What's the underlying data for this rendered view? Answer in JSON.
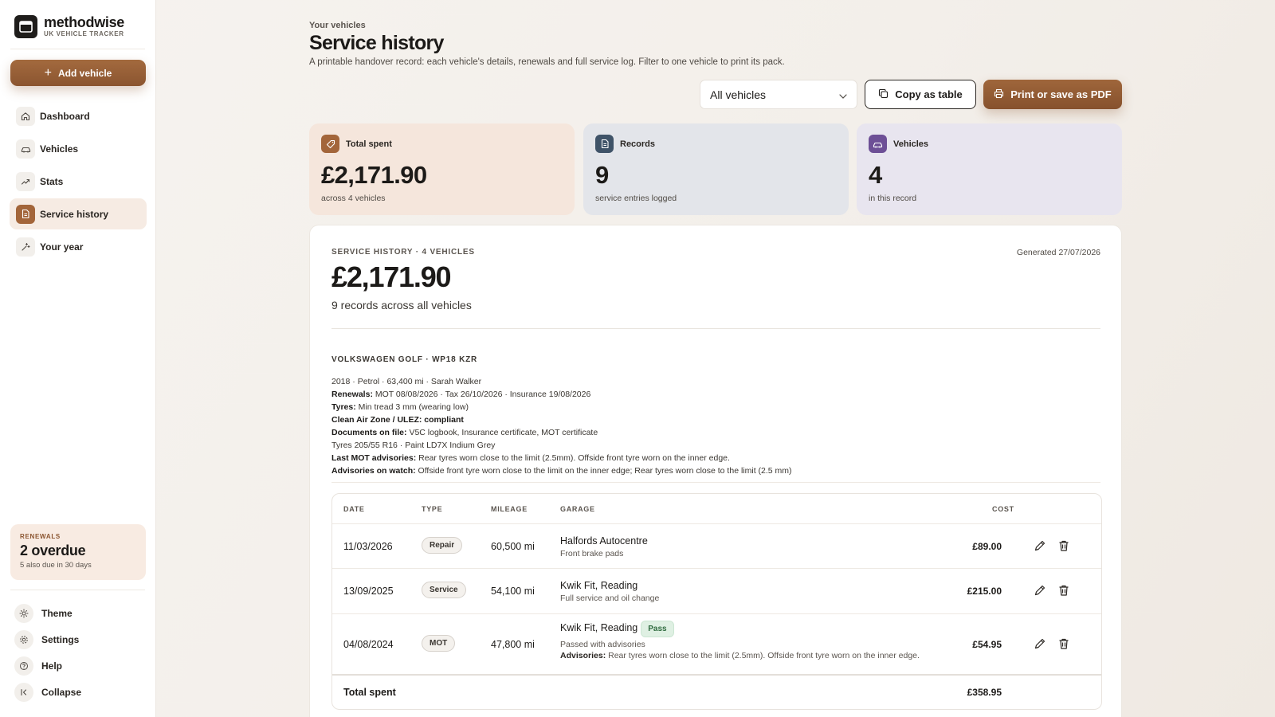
{
  "brand": {
    "name": "methodwise",
    "tagline": "UK VEHICLE TRACKER"
  },
  "sidebar": {
    "add_label": "Add vehicle",
    "items": [
      {
        "label": "Dashboard",
        "icon": "home-icon"
      },
      {
        "label": "Vehicles",
        "icon": "car-icon"
      },
      {
        "label": "Stats",
        "icon": "trend-icon"
      },
      {
        "label": "Service history",
        "icon": "document-icon",
        "active": true
      },
      {
        "label": "Your year",
        "icon": "sparkle-icon"
      }
    ],
    "renewals": {
      "label": "RENEWALS",
      "headline": "2 overdue",
      "sub": "5 also due in 30 days"
    },
    "bottom": [
      {
        "label": "Theme",
        "icon": "sun-icon"
      },
      {
        "label": "Settings",
        "icon": "gear-icon"
      },
      {
        "label": "Help",
        "icon": "help-icon"
      },
      {
        "label": "Collapse",
        "icon": "collapse-icon"
      }
    ]
  },
  "header": {
    "eyebrow": "Your vehicles",
    "title": "Service history",
    "description": "A printable handover record: each vehicle's details, renewals and full service log. Filter to one vehicle to print its pack."
  },
  "toolbar": {
    "filter_value": "All vehicles",
    "copy_label": "Copy as table",
    "print_label": "Print or save as PDF"
  },
  "stats": [
    {
      "label": "Total spent",
      "value": "£2,171.90",
      "sub": "across 4 vehicles",
      "icon": "tag-icon"
    },
    {
      "label": "Records",
      "value": "9",
      "sub": "service entries logged",
      "icon": "document-icon"
    },
    {
      "label": "Vehicles",
      "value": "4",
      "sub": "in this record",
      "icon": "car-icon"
    }
  ],
  "report": {
    "eyebrow": "SERVICE HISTORY · 4 VEHICLES",
    "generated": "Generated 27/07/2026",
    "total": "£2,171.90",
    "sub": "9 records across all vehicles"
  },
  "vehicle": {
    "title": "VOLKSWAGEN GOLF · WP18 KZR",
    "summary": "2018 · Petrol · 63,400 mi · Sarah Walker",
    "renewals_label": "Renewals:",
    "renewals": "MOT 08/08/2026 · Tax 26/10/2026 · Insurance 19/08/2026",
    "tyres_label": "Tyres:",
    "tyres": "Min tread 3 mm (wearing low)",
    "ulez": "Clean Air Zone / ULEZ: compliant",
    "documents_label": "Documents on file:",
    "documents": "V5C logbook, Insurance certificate, MOT certificate",
    "spec": "Tyres 205/55 R16 · Paint LD7X Indium Grey",
    "mot_label": "Last MOT advisories:",
    "mot": "Rear tyres worn close to the limit (2.5mm). Offside front tyre worn on the inner edge.",
    "watch_label": "Advisories on watch:",
    "watch": "Offside front tyre worn close to the limit on the inner edge; Rear tyres worn close to the limit (2.5 mm)"
  },
  "table": {
    "headers": {
      "date": "DATE",
      "type": "TYPE",
      "mileage": "MILEAGE",
      "garage": "GARAGE",
      "cost": "COST"
    },
    "rows": [
      {
        "date": "11/03/2026",
        "type": "Repair",
        "mileage": "60,500 mi",
        "garage": "Halfords Autocentre",
        "note": "Front brake pads",
        "cost": "£89.00"
      },
      {
        "date": "13/09/2025",
        "type": "Service",
        "mileage": "54,100 mi",
        "garage": "Kwik Fit, Reading",
        "note": "Full service and oil change",
        "cost": "£215.00"
      },
      {
        "date": "04/08/2024",
        "type": "MOT",
        "mileage": "47,800 mi",
        "garage": "Kwik Fit, Reading",
        "badge": "Pass",
        "note": "Passed with advisories",
        "advisories_label": "Advisories:",
        "advisories": "Rear tyres worn close to the limit (2.5mm). Offside front tyre worn on the inner edge.",
        "cost": "£54.95"
      }
    ],
    "total_label": "Total spent",
    "total_value": "£358.95"
  }
}
